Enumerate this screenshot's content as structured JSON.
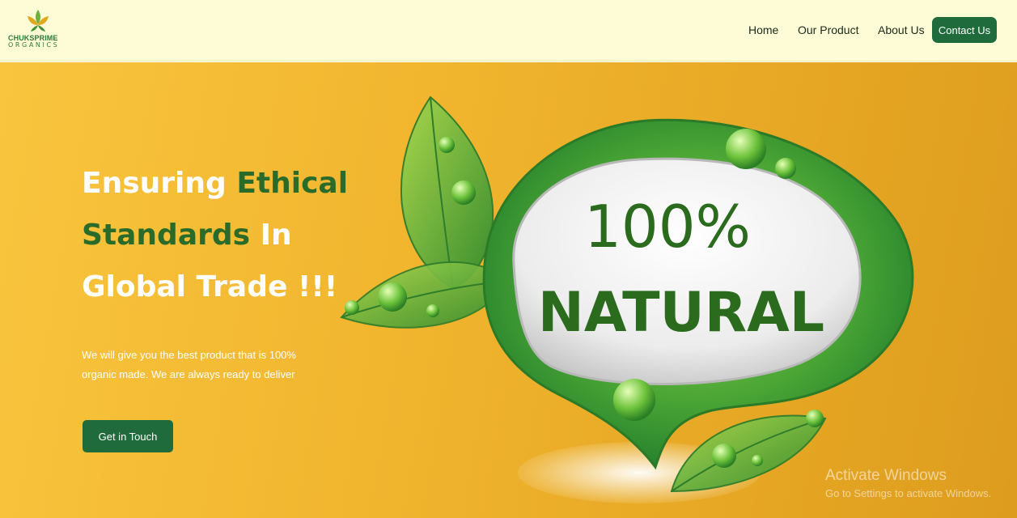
{
  "brand": {
    "name_line1": "CHUKSPRIME",
    "name_line2": "ORGANICS"
  },
  "nav": {
    "home": "Home",
    "product": "Our Product",
    "about": "About Us",
    "contact": "Contact Us"
  },
  "hero": {
    "headline_1": "Ensuring ",
    "headline_2": "Ethical Standards",
    "headline_3": " In Global Trade !!!",
    "subtext": "We will give you the best product that is 100% organic made. We are always ready to deliver",
    "cta": "Get in Touch",
    "badge_line1": "100%",
    "badge_line2": "NATURAL"
  },
  "watermark": {
    "line1": "Activate Windows",
    "line2": "Go to Settings to activate Windows."
  },
  "colors": {
    "nav_bg": "#fdfcd6",
    "accent_green": "#1f6b3c",
    "headline_green": "#2a6b2a",
    "hero_yellow": "#f1b52e"
  },
  "icons": {
    "logo": "leaf-logo-icon",
    "badge": "natural-leaf-badge-icon"
  }
}
